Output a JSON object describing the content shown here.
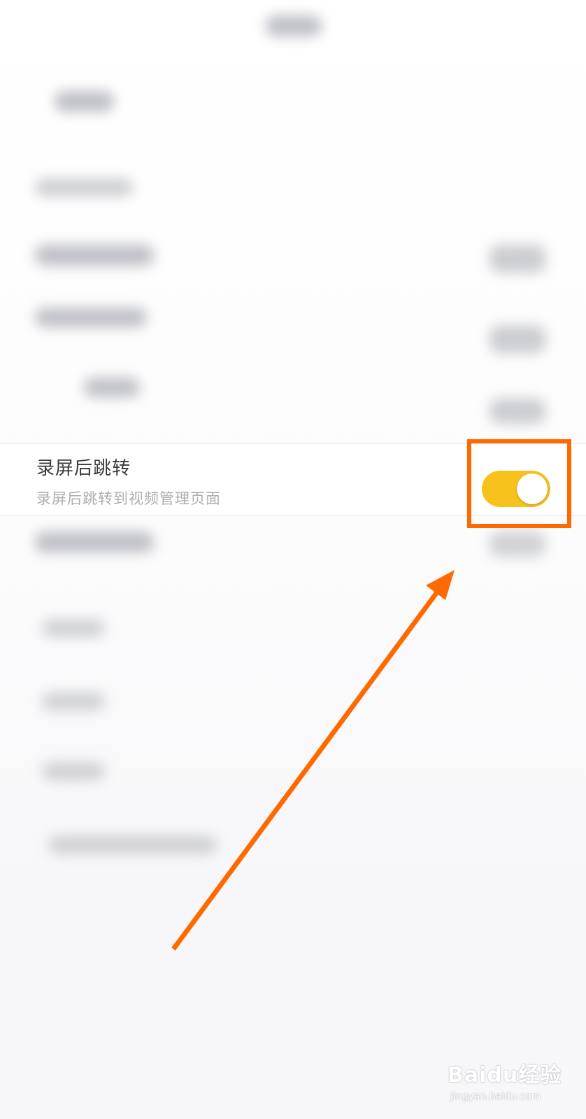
{
  "setting": {
    "title": "录屏后跳转",
    "description": "录屏后跳转到视频管理页面",
    "enabled": true
  },
  "watermark": {
    "logo": "Baidu经验",
    "url": "jingyan.baidu.com"
  },
  "colors": {
    "toggle_on": "#f8c21c",
    "highlight": "#ff6a00",
    "background": "#f7f7f9"
  }
}
